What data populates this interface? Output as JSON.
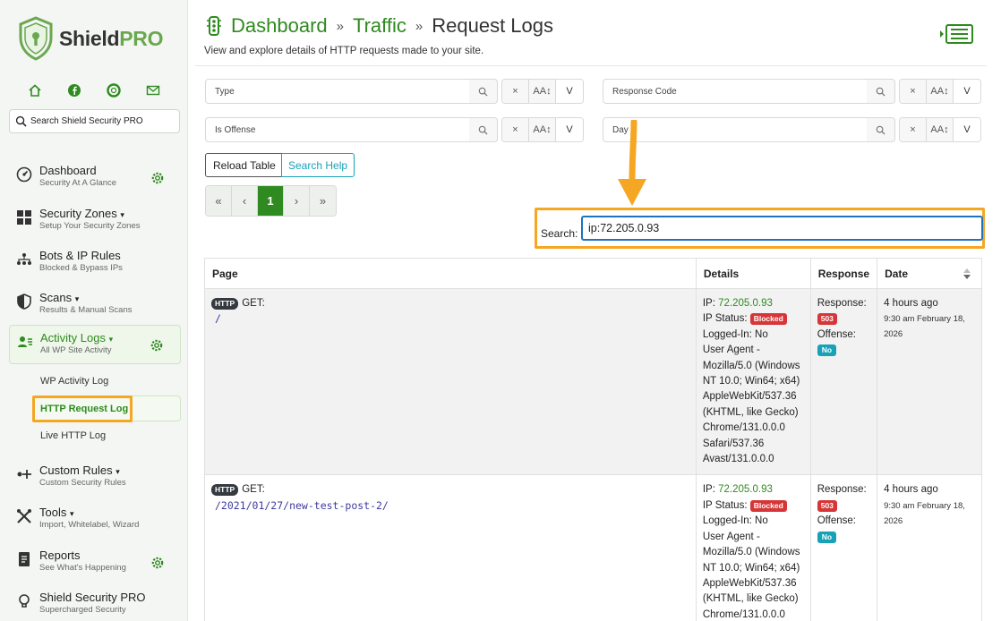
{
  "brand": {
    "name_a": "Shield",
    "name_b": "PRO",
    "color": "#6aa84f"
  },
  "sidebar": {
    "search_placeholder": "Search Shield Security PRO",
    "social_icons": [
      "home-icon",
      "facebook-icon",
      "lifebuoy-icon",
      "envelope-icon"
    ],
    "items": [
      {
        "title": "Dashboard",
        "sub": "Security At A Glance"
      },
      {
        "title": "Security Zones",
        "caret": "▾",
        "sub": "Setup Your Security Zones"
      },
      {
        "title": "Bots & IP Rules",
        "sub": "Blocked & Bypass IPs"
      },
      {
        "title": "Scans",
        "caret": "▾",
        "sub": "Results & Manual Scans"
      },
      {
        "title": "Activity Logs",
        "caret": "▾",
        "sub": "All WP Site Activity"
      },
      {
        "title": "Custom Rules",
        "caret": "▾",
        "sub": "Custom Security Rules"
      },
      {
        "title": "Tools",
        "caret": "▾",
        "sub": "Import, Whitelabel, Wizard"
      },
      {
        "title": "Reports",
        "sub": "See What's Happening"
      },
      {
        "title": "Shield Security PRO",
        "sub": "Supercharged Security"
      }
    ],
    "subitems": [
      "WP Activity Log",
      "HTTP Request Log",
      "Live HTTP Log"
    ]
  },
  "header": {
    "crumb1": "Dashboard",
    "crumb2": "Traffic",
    "current": "Request Logs",
    "sep": "»",
    "subtitle": "View and explore details of HTTP requests made to your site."
  },
  "filters": [
    {
      "label": "Type"
    },
    {
      "label": "Response Code"
    },
    {
      "label": "Is Offense"
    },
    {
      "label": "Day"
    }
  ],
  "filter_buttons": {
    "clear": "×",
    "case": "AA↕",
    "toggle": "V"
  },
  "actions": {
    "reload": "Reload Table",
    "help": "Search Help"
  },
  "pager": [
    "«",
    "‹",
    "1",
    "›",
    "»"
  ],
  "search": {
    "label": "Search:",
    "value": "ip:72.205.0.93"
  },
  "table": {
    "headers": [
      "Page",
      "Details",
      "Response",
      "Date"
    ],
    "rows": [
      {
        "method_badge": "HTTP",
        "method": "GET:",
        "path": "/",
        "ip_label": "IP:",
        "ip": "72.205.0.93",
        "status_label": "IP Status:",
        "status": "Blocked",
        "logged_in": "Logged-In: No",
        "ua": [
          "User Agent -",
          "Mozilla/5.0 (Windows",
          "NT 10.0; Win64; x64)",
          "AppleWebKit/537.36",
          "(KHTML, like Gecko)",
          "Chrome/131.0.0.0",
          "Safari/537.36",
          "Avast/131.0.0.0"
        ],
        "response_label": "Response:",
        "response": "503",
        "offense_label": "Offense:",
        "offense": "No",
        "date_rel": "4 hours ago",
        "date_abs": [
          "9:30 am February 18,",
          "2026"
        ]
      },
      {
        "method_badge": "HTTP",
        "method": "GET:",
        "path": "/2021/01/27/new-test-post-2/",
        "ip_label": "IP:",
        "ip": "72.205.0.93",
        "status_label": "IP Status:",
        "status": "Blocked",
        "logged_in": "Logged-In: No",
        "ua": [
          "User Agent -",
          "Mozilla/5.0 (Windows",
          "NT 10.0; Win64; x64)",
          "AppleWebKit/537.36",
          "(KHTML, like Gecko)",
          "Chrome/131.0.0.0"
        ],
        "response_label": "Response:",
        "response": "503",
        "offense_label": "Offense:",
        "offense": "No",
        "date_rel": "4 hours ago",
        "date_abs": [
          "9:30 am February 18,",
          "2026"
        ]
      }
    ]
  },
  "colors": {
    "green": "#2f8a1f",
    "highlight": "#f5a623",
    "blocked": "#d63638",
    "info": "#17a2b8"
  }
}
